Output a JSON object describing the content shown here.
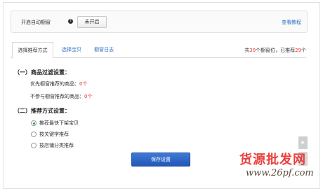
{
  "topbar": {
    "auto_label": "开启自动橱窗",
    "help_glyph": "?",
    "toggle_label": "未开启",
    "tutorial_link": "查看教程"
  },
  "tabs": [
    {
      "label": "选择推荐方式",
      "active": true
    },
    {
      "label": "选择宝贝",
      "active": false
    },
    {
      "label": "橱窗日志",
      "active": false
    }
  ],
  "stats": {
    "prefix": "共",
    "total": "30",
    "mid": "个橱窗位，已推荐",
    "recommended": "29",
    "suffix": "个"
  },
  "filter": {
    "title": "（一）商品过滤设置：",
    "priority_label": "优先橱窗推荐的商品：",
    "priority_count": "0个",
    "exclude_label": "不参与橱窗推荐的商品：",
    "exclude_count": "0个"
  },
  "method": {
    "title": "（二）推荐方式设置：",
    "options": [
      {
        "label": "推荐最快下架宝贝",
        "checked": true
      },
      {
        "label": "按关键字推荐",
        "checked": false
      },
      {
        "label": "按店铺分类推荐",
        "checked": false
      }
    ]
  },
  "save_label": "保存设置",
  "watermark": {
    "text": "货源批发网",
    "url": "www.26pf.com"
  },
  "colors": {
    "link": "#2d6fc4",
    "accent_red": "#e0322c",
    "primary_button": "#2a62c4",
    "radio_checked": "#3a9a3a"
  }
}
